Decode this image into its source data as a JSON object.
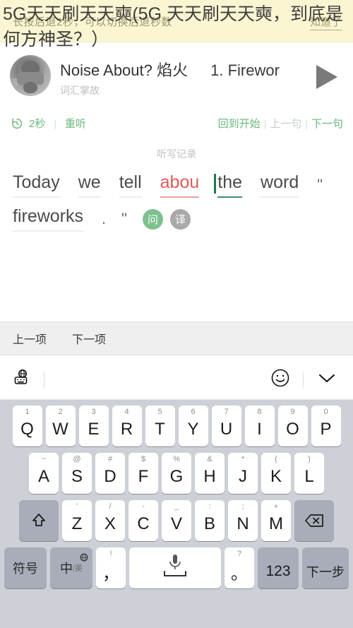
{
  "tip_banner": {
    "message": "长按后退2秒，可以切换后退秒数",
    "ack_label": "知道了",
    "bg_color": "#faf6d2"
  },
  "overlay_title": "5G天天刷天天奭(5G 天天刷天天奭，到底是何方神圣？）",
  "player": {
    "avatar_name": "podcast-avatar",
    "title": "Noise About? 焰火",
    "episode": "1. Firewor",
    "subtitle": "词汇掌故",
    "play_icon": "play-triangle-icon"
  },
  "controls": {
    "rewind_icon": "rewind-circle-icon",
    "rewind_seconds": "2秒",
    "separator": "|",
    "replay_label": "重听",
    "back_to_start": "回到开始",
    "prev_sentence": "上一句",
    "next_sentence": "下一句",
    "accent_color": "#6cb77f",
    "disabled_color": "#c6cfc8"
  },
  "dictation": {
    "section_label": "听写记录",
    "line1": [
      {
        "text": "Today",
        "state": "normal"
      },
      {
        "text": "we",
        "state": "normal"
      },
      {
        "text": "tell",
        "state": "normal"
      },
      {
        "text": "abou",
        "state": "error"
      },
      {
        "text": "the",
        "state": "cursor"
      },
      {
        "text": "word",
        "state": "normal"
      },
      {
        "text": "\"",
        "state": "punct"
      }
    ],
    "line2": [
      {
        "text": "fireworks",
        "state": "normal"
      },
      {
        "text": ".",
        "state": "punct"
      },
      {
        "text": "\"",
        "state": "punct"
      }
    ],
    "ask_button": "问",
    "translate_button": "译",
    "error_color": "#e05a5a",
    "cursor_color": "#1f7a53",
    "ask_color": "#7dc18e",
    "translate_color": "#a9a9a9"
  },
  "item_nav": {
    "prev_item": "上一项",
    "next_item": "下一项"
  },
  "keyboard_toolbar": {
    "input_method_icon": "globe-keyboard-icon",
    "emoji_icon": "smiley-icon",
    "collapse_icon": "chevron-down-icon"
  },
  "keyboard": {
    "row1": [
      {
        "hint": "1",
        "main": "Q"
      },
      {
        "hint": "2",
        "main": "W"
      },
      {
        "hint": "3",
        "main": "E"
      },
      {
        "hint": "4",
        "main": "R"
      },
      {
        "hint": "5",
        "main": "T"
      },
      {
        "hint": "6",
        "main": "Y"
      },
      {
        "hint": "7",
        "main": "U"
      },
      {
        "hint": "8",
        "main": "I"
      },
      {
        "hint": "9",
        "main": "O"
      },
      {
        "hint": "0",
        "main": "P"
      }
    ],
    "row2": [
      {
        "hint": "~",
        "main": "A"
      },
      {
        "hint": "@",
        "main": "S"
      },
      {
        "hint": "#",
        "main": "D"
      },
      {
        "hint": "$",
        "main": "F"
      },
      {
        "hint": "%",
        "main": "G"
      },
      {
        "hint": "&",
        "main": "H"
      },
      {
        "hint": "*",
        "main": "J"
      },
      {
        "hint": "(",
        "main": "K"
      },
      {
        "hint": ")",
        "main": "L"
      }
    ],
    "row3": [
      {
        "hint": "'",
        "main": "Z"
      },
      {
        "hint": "/",
        "main": "X"
      },
      {
        "hint": "-",
        "main": "C"
      },
      {
        "hint": "_",
        "main": "V"
      },
      {
        "hint": ":",
        "main": "B"
      },
      {
        "hint": ";",
        "main": "N"
      },
      {
        "hint": "+",
        "main": "M"
      }
    ],
    "shift_icon": "shift-arrow-icon",
    "backspace_icon": "backspace-icon",
    "symbols_label": "符号",
    "lang_main": "中",
    "lang_sub": "/英",
    "lang_globe_icon": "globe-icon",
    "comma_hint": "!",
    "comma_main": "，",
    "space_icon": "microphone-icon",
    "period_hint": "?",
    "period_main": "。",
    "numeric_label": "123",
    "next_step_label": "下一步",
    "key_bg": "#ffffff",
    "key_dark_bg": "#a9adb9",
    "keyboard_bg": "#ced0d8"
  }
}
